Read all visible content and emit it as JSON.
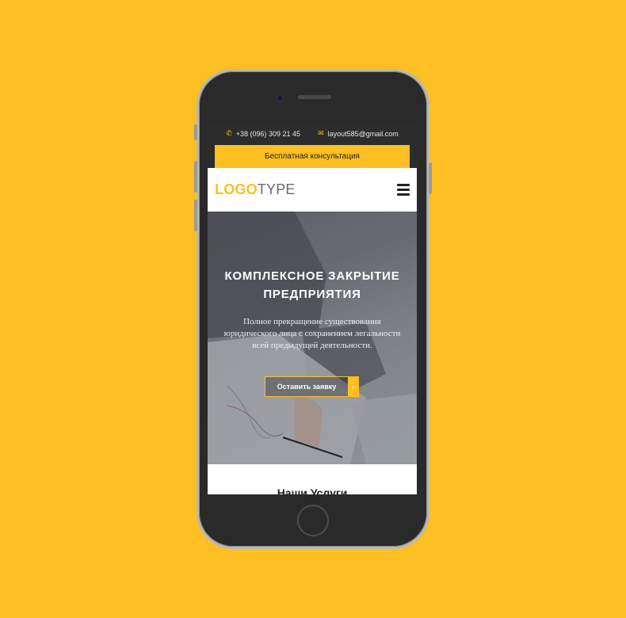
{
  "colors": {
    "background": "#fdbf22",
    "accent": "#fdbf22",
    "dark": "#2c2c2c"
  },
  "topbar": {
    "phone_icon": "phone-icon",
    "phone": "+38 (096) 309 21 45",
    "email_icon": "envelope-icon",
    "email": "layout585@gmail.com"
  },
  "consult_button": "Бесплатная консультация",
  "header": {
    "logo_part1": "LOGO",
    "logo_part2": "TYPE",
    "menu_icon": "hamburger-icon"
  },
  "hero": {
    "title_line1": "КОМПЛЕКСНОЕ ЗАКРЫТИЕ",
    "title_line2": "ПРЕДПРИЯТИЯ",
    "subtitle_line1": "Полное прекращение существования",
    "subtitle_line2": "юридического лица с сохранением легальности",
    "subtitle_line3": "всей предыдущей деятельности.",
    "cta_label": "Оставить заявку",
    "cta_arrow": "›"
  },
  "services": {
    "title": "Наши Услуги"
  }
}
